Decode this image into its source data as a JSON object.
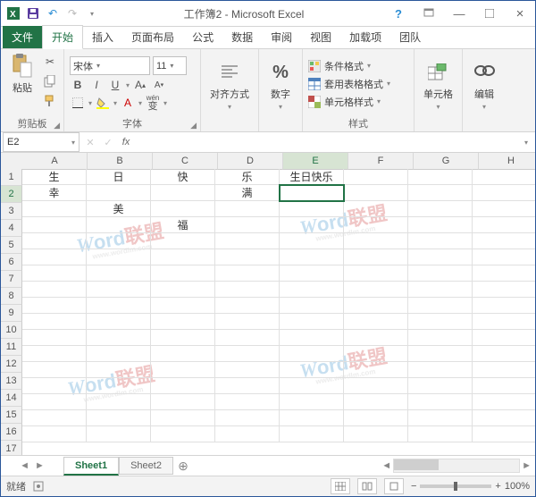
{
  "app": {
    "title": "工作簿2 - Microsoft Excel"
  },
  "tabs": {
    "file": "文件",
    "home": "开始",
    "insert": "插入",
    "layout": "页面布局",
    "formulas": "公式",
    "data": "数据",
    "review": "审阅",
    "view": "视图",
    "addins": "加载项",
    "team": "团队"
  },
  "ribbon": {
    "clipboard": {
      "label": "剪贴板",
      "paste": "粘贴"
    },
    "font": {
      "label": "字体",
      "family": "宋体",
      "size": "11",
      "pinyin": "wén",
      "char": "变"
    },
    "align": {
      "label": "对齐方式"
    },
    "number": {
      "label": "数字",
      "percent": "%"
    },
    "styles": {
      "label": "样式",
      "cond": "条件格式",
      "table": "套用表格格式",
      "cell": "单元格样式"
    },
    "cells": {
      "label": "单元格"
    },
    "edit": {
      "label": "编辑"
    }
  },
  "formula_bar": {
    "name": "E2",
    "fx": "fx",
    "value": ""
  },
  "grid": {
    "cols": [
      "A",
      "B",
      "C",
      "D",
      "E",
      "F",
      "G",
      "H"
    ],
    "rowcount": 17,
    "selected": {
      "col": 4,
      "row": 1
    },
    "cells": {
      "r1": {
        "A": "生",
        "B": "日",
        "C": "快",
        "D": "乐",
        "E": "生日快乐"
      },
      "r2": {
        "A": "幸",
        "D": "满"
      },
      "r3": {
        "B": "美"
      },
      "r4": {
        "C": "福"
      }
    }
  },
  "sheets": {
    "s1": "Sheet1",
    "s2": "Sheet2"
  },
  "status": {
    "ready": "就绪",
    "zoom": "100%"
  },
  "watermark": {
    "w": "W",
    "ord": "ord",
    "cn": "联盟",
    "url": "www.wordlm.com"
  }
}
